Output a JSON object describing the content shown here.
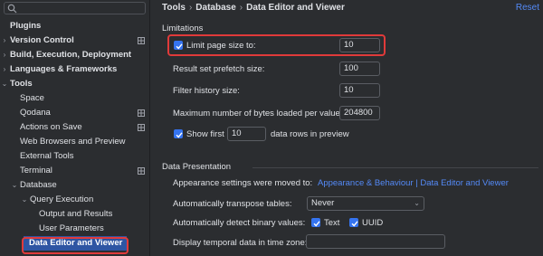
{
  "search": {
    "value": "",
    "icon": "search-icon"
  },
  "sidebar": {
    "items": [
      {
        "label": "Plugins",
        "depth": 0,
        "bold": true,
        "arrow": ""
      },
      {
        "label": "Version Control",
        "depth": 0,
        "bold": true,
        "arrow": "›",
        "settings": true
      },
      {
        "label": "Build, Execution, Deployment",
        "depth": 0,
        "bold": true,
        "arrow": "›"
      },
      {
        "label": "Languages & Frameworks",
        "depth": 0,
        "bold": true,
        "arrow": "›"
      },
      {
        "label": "Tools",
        "depth": 0,
        "bold": true,
        "arrow": "⌄"
      },
      {
        "label": "Space",
        "depth": 1,
        "arrow": ""
      },
      {
        "label": "Qodana",
        "depth": 1,
        "arrow": "",
        "settings": true
      },
      {
        "label": "Actions on Save",
        "depth": 1,
        "arrow": "",
        "settings": true
      },
      {
        "label": "Web Browsers and Preview",
        "depth": 1,
        "arrow": ""
      },
      {
        "label": "External Tools",
        "depth": 1,
        "arrow": ""
      },
      {
        "label": "Terminal",
        "depth": 1,
        "arrow": "",
        "settings": true
      },
      {
        "label": "Database",
        "depth": 1,
        "arrow": "⌄"
      },
      {
        "label": "Query Execution",
        "depth": 2,
        "arrow": "⌄"
      },
      {
        "label": "Output and Results",
        "depth": 3,
        "arrow": ""
      },
      {
        "label": "User Parameters",
        "depth": 3,
        "arrow": ""
      },
      {
        "label": "Data Editor and Viewer",
        "depth": 2,
        "arrow": "",
        "selected": true
      }
    ]
  },
  "breadcrumb": [
    "Tools",
    "Database",
    "Data Editor and Viewer"
  ],
  "breadcrumb_sep": "›",
  "reset_label": "Reset",
  "limitations": {
    "title": "Limitations",
    "limit_page_size_label": "Limit page size to:",
    "limit_page_size_checked": true,
    "limit_page_size_value": "10",
    "prefetch_label": "Result set prefetch size:",
    "prefetch_value": "100",
    "filter_history_label": "Filter history size:",
    "filter_history_value": "10",
    "max_bytes_label": "Maximum number of bytes loaded per value:",
    "max_bytes_value": "204800",
    "show_first_label": "Show first",
    "show_first_checked": true,
    "show_first_value": "10",
    "show_first_suffix": "data rows in preview"
  },
  "data_presentation": {
    "title": "Data Presentation",
    "appearance_text": "Appearance settings were moved to:",
    "appearance_link": "Appearance & Behaviour | Data Editor and Viewer",
    "transpose_label": "Automatically transpose tables:",
    "transpose_value": "Never",
    "binary_label": "Automatically detect binary values:",
    "binary_text_label": "Text",
    "binary_text_checked": true,
    "binary_uuid_label": "UUID",
    "binary_uuid_checked": true,
    "temporal_label": "Display temporal data in time zone:",
    "temporal_value": ""
  },
  "colors": {
    "background": "#2b2d30",
    "accent": "#3574f0",
    "link": "#548af7",
    "selection": "#2e55a3",
    "highlight_box": "#e03a3a"
  }
}
